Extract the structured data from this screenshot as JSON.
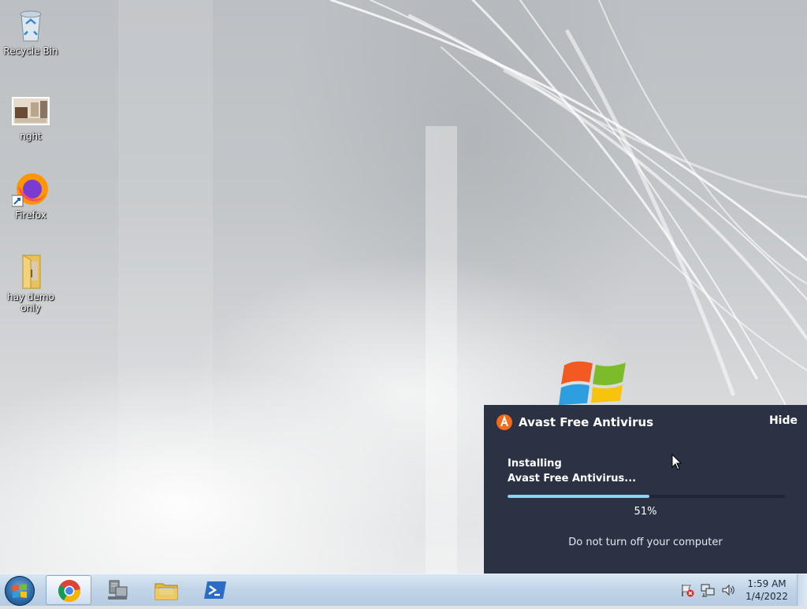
{
  "desktop": {
    "icons": [
      {
        "label": "Recycle Bin",
        "icon": "recycle-bin-icon"
      },
      {
        "label": "nght",
        "icon": "image-thumbnail-icon"
      },
      {
        "label": "Firefox",
        "icon": "firefox-icon"
      },
      {
        "label": "hay demo only",
        "icon": "folder-icon"
      }
    ]
  },
  "avast_popup": {
    "title": "Avast Free Antivirus",
    "hide_label": "Hide",
    "status_line1": "Installing",
    "status_line2": "Avast Free Antivirus...",
    "progress_percent": 51,
    "progress_text": "51%",
    "warning": "Do not turn off your computer",
    "colors": {
      "background": "#2b3244",
      "progress": "#8fd3f4",
      "logo": "#f26a1b"
    }
  },
  "taskbar": {
    "start_icon": "windows-start-icon",
    "pinned": [
      {
        "name": "chrome",
        "icon": "chrome-icon",
        "active": true
      },
      {
        "name": "network-tool",
        "icon": "network-computer-icon",
        "active": false
      },
      {
        "name": "explorer",
        "icon": "folder-icon",
        "active": false
      },
      {
        "name": "powershell",
        "icon": "powershell-icon",
        "active": false
      }
    ],
    "tray_icons": [
      "action-center-flag-icon",
      "network-icon",
      "volume-icon"
    ],
    "clock": {
      "time": "1:59 AM",
      "date": "1/4/2022"
    }
  }
}
